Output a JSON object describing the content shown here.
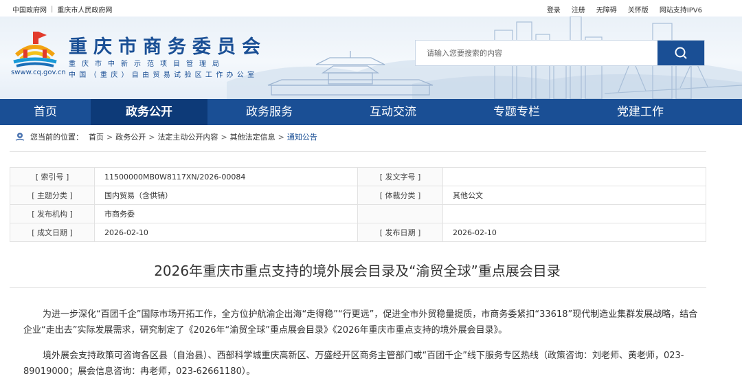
{
  "topbar": {
    "left": [
      "中国政府网",
      "重庆市人民政府网"
    ],
    "right": [
      "登录",
      "注册",
      "无障碍",
      "关怀版",
      "网站支持IPV6"
    ]
  },
  "header": {
    "logo_url": "swww.cq.gov.cn",
    "title": "重庆市商务委员会",
    "subtitle1": "重庆市中新示范项目管理局",
    "subtitle2": "中国（重庆）自由贸易试验区工作办公室",
    "search_placeholder": "请输入您要搜索的内容"
  },
  "nav": [
    "首页",
    "政务公开",
    "政务服务",
    "互动交流",
    "专题专栏",
    "党建工作"
  ],
  "breadcrumb": {
    "label": "您当前的位置：",
    "items": [
      "首页",
      "政务公开",
      "法定主动公开内容",
      "其他法定信息",
      "通知公告"
    ]
  },
  "info": {
    "rows": [
      {
        "k1": "[ 索引号 ]",
        "v1": "11500000MB0W8117XN/2026-00084",
        "k2": "[ 发文字号 ]",
        "v2": ""
      },
      {
        "k1": "[ 主题分类 ]",
        "v1": "国内贸易（含供销）",
        "k2": "[ 体裁分类 ]",
        "v2": "其他公文"
      },
      {
        "k1": "[ 发布机构 ]",
        "v1": "市商务委",
        "k2": "",
        "v2": ""
      },
      {
        "k1": "[ 成文日期 ]",
        "v1": "2026-02-10",
        "k2": "[ 发布日期 ]",
        "v2": "2026-02-10"
      }
    ]
  },
  "article": {
    "title": "2026年重庆市重点支持的境外展会目录及“渝贸全球”重点展会目录",
    "p1": "为进一步深化“百团千企”国际市场开拓工作，全方位护航渝企出海“走得稳”“行更远”，促进全市外贸稳量提质，市商务委紧扣“33618”现代制造业集群发展战略，结合企业“走出去”实际发展需求，研究制定了《2026年“渝贸全球”重点展会目录》《2026年重庆市重点支持的境外展会目录》。",
    "p2": "境外展会支持政策可咨询各区县（自治县）、西部科学城重庆高新区、万盛经开区商务主管部门或“百团千企”线下服务专区热线（政策咨询：刘老师、黄老师，023-89019000；展会信息咨询：冉老师，023-62661180）。"
  },
  "colors": {
    "brand": "#1a4f95",
    "nav_active": "#0d3a78"
  },
  "icons": [
    "location-pin-icon",
    "search-icon",
    "emblem-logo"
  ]
}
